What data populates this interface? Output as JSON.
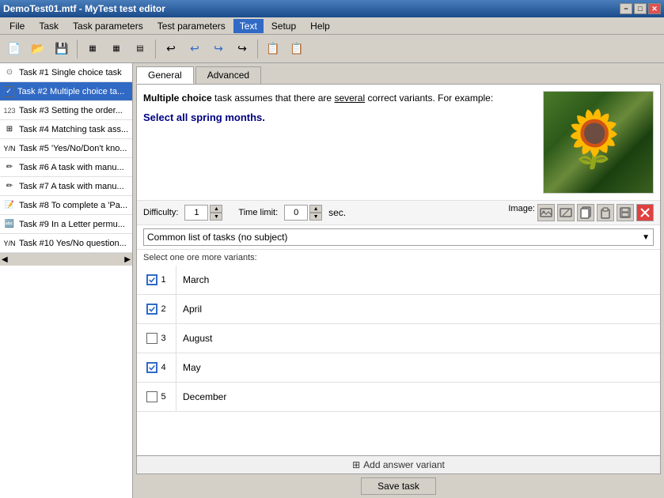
{
  "window": {
    "title": "DemoTest01.mtf - MyTest test editor"
  },
  "title_bar": {
    "minimize": "−",
    "maximize": "□",
    "close": "✕"
  },
  "menu": {
    "items": [
      {
        "id": "file",
        "label": "File"
      },
      {
        "id": "task",
        "label": "Task"
      },
      {
        "id": "task-parameters",
        "label": "Task parameters"
      },
      {
        "id": "test-parameters",
        "label": "Test parameters"
      },
      {
        "id": "text",
        "label": "Text"
      },
      {
        "id": "setup",
        "label": "Setup"
      },
      {
        "id": "help",
        "label": "Help"
      }
    ]
  },
  "toolbar": {
    "buttons": [
      {
        "id": "new",
        "icon": "📄"
      },
      {
        "id": "open",
        "icon": "📂"
      },
      {
        "id": "save",
        "icon": "💾"
      },
      {
        "id": "sep1",
        "type": "separator"
      },
      {
        "id": "indent",
        "icon": "⬛"
      },
      {
        "id": "outdent",
        "icon": "⬛"
      },
      {
        "id": "sort",
        "icon": "⬛"
      },
      {
        "id": "sep2",
        "type": "separator"
      },
      {
        "id": "undo",
        "icon": "↩"
      },
      {
        "id": "redo-back",
        "icon": "↩"
      },
      {
        "id": "redo",
        "icon": "↪"
      },
      {
        "id": "redo2",
        "icon": "↪"
      },
      {
        "id": "sep3",
        "type": "separator"
      },
      {
        "id": "copy",
        "icon": "📋"
      },
      {
        "id": "paste",
        "icon": "📋"
      }
    ]
  },
  "sidebar": {
    "tasks": [
      {
        "id": 1,
        "label": "Task #1 Single choice task",
        "checked": false,
        "selected": false,
        "icon_type": "single"
      },
      {
        "id": 2,
        "label": "Task #2 Multiple choice ta...",
        "checked": true,
        "selected": true,
        "icon_type": "multi"
      },
      {
        "id": 3,
        "label": "Task #3 Setting the order...",
        "checked": false,
        "selected": false,
        "icon_type": "single"
      },
      {
        "id": 4,
        "label": "Task #4 Matching task ass...",
        "checked": false,
        "selected": false,
        "icon_type": "single"
      },
      {
        "id": 5,
        "label": "Task #5 'Yes/No/Don't kno...",
        "checked": false,
        "selected": false,
        "icon_type": "single"
      },
      {
        "id": 6,
        "label": "Task #6 A task with manu...",
        "checked": false,
        "selected": false,
        "icon_type": "single"
      },
      {
        "id": 7,
        "label": "Task #7 A task with manu...",
        "checked": false,
        "selected": false,
        "icon_type": "single"
      },
      {
        "id": 8,
        "label": "Task #8 To complete a 'Pa...",
        "checked": false,
        "selected": false,
        "icon_type": "single"
      },
      {
        "id": 9,
        "label": "Task #9 In a Letter permu...",
        "checked": false,
        "selected": false,
        "icon_type": "single"
      },
      {
        "id": 10,
        "label": "Task #10 Yes/No question...",
        "checked": false,
        "selected": false,
        "icon_type": "single"
      }
    ]
  },
  "tabs": {
    "items": [
      {
        "id": "general",
        "label": "General",
        "active": true
      },
      {
        "id": "advanced",
        "label": "Advanced",
        "active": false
      }
    ]
  },
  "task": {
    "description_part1": "Multiple choice",
    "description_part2": " task assumes that there are ",
    "description_underline": "several",
    "description_part3": " correct variants. For example:",
    "prompt": "Select all spring months.",
    "difficulty_label": "Difficulty:",
    "difficulty_value": "1",
    "time_limit_label": "Time limit:",
    "time_limit_value": "0",
    "time_unit": "sec.",
    "image_label": "Image:",
    "subject_dropdown": "Common list of tasks (no subject)",
    "select_prompt": "Select one ore more variants:",
    "variants": [
      {
        "id": 1,
        "text": "March",
        "checked": true
      },
      {
        "id": 2,
        "text": "April",
        "checked": true
      },
      {
        "id": 3,
        "text": "August",
        "checked": false
      },
      {
        "id": 4,
        "text": "May",
        "checked": true
      },
      {
        "id": 5,
        "text": "December",
        "checked": false
      }
    ],
    "add_variant_label": "Add answer variant",
    "save_button": "Save task"
  },
  "image_toolbar": {
    "buttons": [
      {
        "id": "img-add",
        "icon": "🖼"
      },
      {
        "id": "img-edit",
        "icon": "✏"
      },
      {
        "id": "img-copy",
        "icon": "📋"
      },
      {
        "id": "img-paste",
        "icon": "📌"
      },
      {
        "id": "img-save",
        "icon": "💾"
      },
      {
        "id": "img-delete",
        "icon": "✕",
        "red": true
      }
    ]
  }
}
